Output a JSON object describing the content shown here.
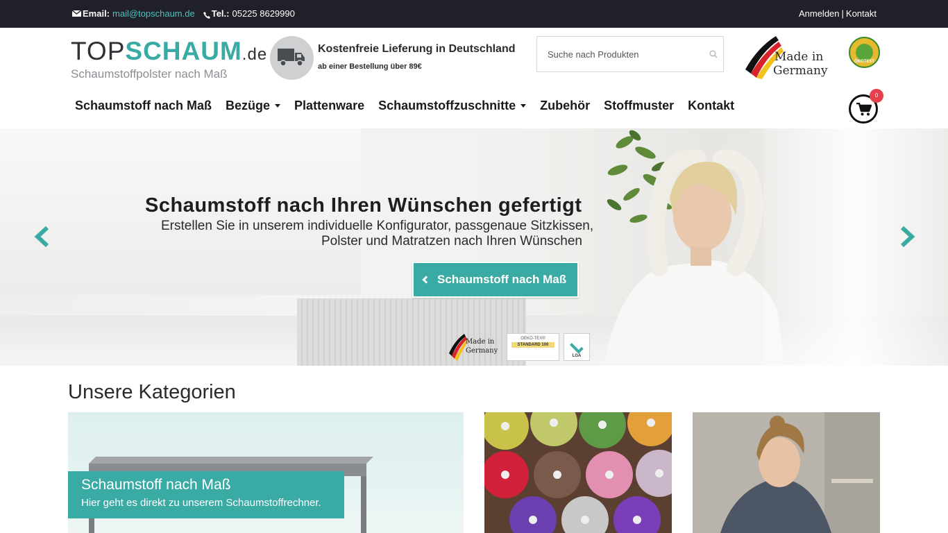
{
  "topbar": {
    "email_label": "Email:",
    "email": "mail@topschaum.de",
    "tel_label": "Tel.:",
    "tel": "05225 8629990",
    "login": "Anmelden",
    "separator": "|",
    "contact": "Kontakt"
  },
  "logo": {
    "part1": "TOP",
    "part2": "SCHAUM",
    "part3": ".de",
    "tagline": "Schaumstoffpolster nach Maß"
  },
  "shipping": {
    "title": "Kostenfreie Lieferung in Deutschland",
    "subtitle": "ab einer Bestellung über 89€",
    "icon": "truck-icon"
  },
  "search": {
    "placeholder": "Suche nach Produkten",
    "value": "",
    "icon": "search-icon"
  },
  "badges": {
    "made_in_line1": "Made in",
    "made_in_line2": "Germany",
    "oeko_label": "ÖKOTEST"
  },
  "nav": {
    "items": [
      {
        "label": "Schaumstoff nach Maß",
        "dropdown": false
      },
      {
        "label": "Bezüge",
        "dropdown": true
      },
      {
        "label": "Plattenware",
        "dropdown": false
      },
      {
        "label": "Schaumstoffzuschnitte",
        "dropdown": true
      },
      {
        "label": "Zubehör",
        "dropdown": false
      },
      {
        "label": "Stoffmuster",
        "dropdown": false
      },
      {
        "label": "Kontakt",
        "dropdown": false
      }
    ],
    "cart_count": "0"
  },
  "hero": {
    "title": "Schaumstoff nach Ihren Wünschen gefertigt",
    "line1": "Erstellen Sie in unserem individuelle Konfigurator, passgenaue Sitzkissen,",
    "line2": "Polster und Matratzen nach Ihren Wünschen",
    "button": "Schaumstoff nach Maß",
    "badge_made_in_1": "Made in",
    "badge_made_in_2": "Germany",
    "badge_oeko_1": "OEKO-TEX®",
    "badge_oeko_2": "STANDARD 100",
    "badge_lga": "LGA"
  },
  "categories": {
    "heading": "Unsere Kategorien",
    "tiles": [
      {
        "title": "Schaumstoff nach Maß",
        "subtitle": "Hier geht es direkt zu unserem Schaumstoffrechner."
      }
    ]
  },
  "colors": {
    "accent": "#3aaaa4",
    "topbar": "#1f2028",
    "cart_badge": "#e5404b"
  }
}
